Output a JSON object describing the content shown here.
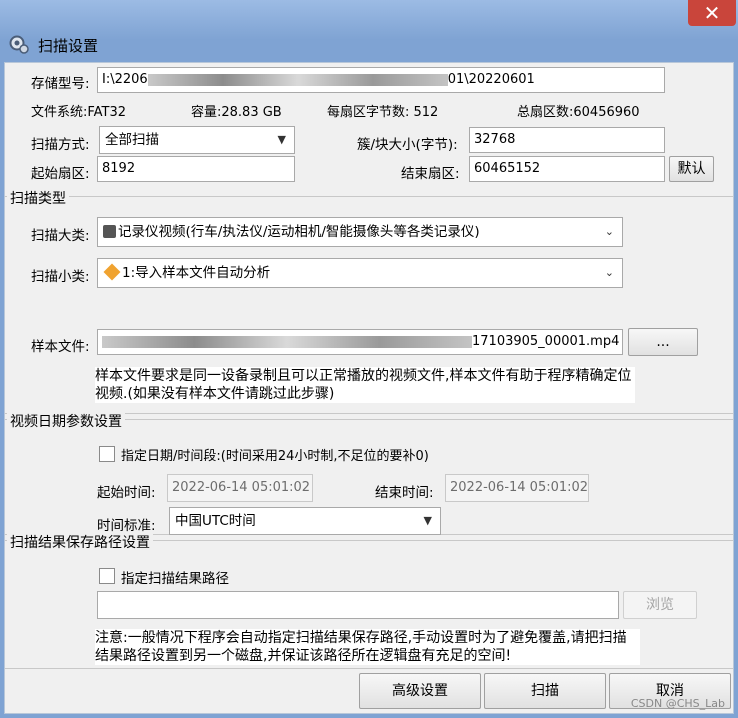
{
  "window": {
    "title": "扫描设置",
    "close_glyph": "✕",
    "icon": "gear-scan-icon"
  },
  "device": {
    "storage_label": "存储型号:",
    "storage_prefix": "I:\\2206",
    "storage_suffix": "01\\20220601",
    "fs_label": "文件系统:FAT32",
    "capacity_label": "容量:28.83 GB",
    "bytes_per_sector_label": "每扇区字节数: 512",
    "total_sectors_label": "总扇区数:60456960",
    "scan_mode_label": "扫描方式:",
    "scan_mode_value": "全部扫描",
    "cluster_label": "簇/块大小(字节):",
    "cluster_value": "32768",
    "start_sector_label": "起始扇区:",
    "start_sector_value": "8192",
    "end_sector_label": "结束扇区:",
    "end_sector_value": "60465152",
    "default_button": "默认"
  },
  "scan_type": {
    "group_title": "扫描类型",
    "major_label": "扫描大类:",
    "major_value": "记录仪视频(行车/执法仪/运动相机/智能摄像头等各类记录仪)",
    "minor_label": "扫描小类:",
    "minor_value": "1:导入样本文件自动分析",
    "sample_label": "样本文件:",
    "sample_suffix": "17103905_00001.mp4",
    "browse_dots": "...",
    "sample_note": "样本文件要求是同一设备录制且可以正常播放的视频文件,样本文件有助于程序精确定位视频.(如果没有样本文件请跳过此步骤)"
  },
  "date_params": {
    "group_title": "视频日期参数设置",
    "specify_label": "指定日期/时间段:(时间采用24小时制,不足位的要补0)",
    "start_label": "起始时间:",
    "start_value": "2022-06-14 05:01:02",
    "end_label": "结束时间:",
    "end_value": "2022-06-14 05:01:02",
    "tz_label": "时间标准:",
    "tz_value": "中国UTC时间"
  },
  "save_path": {
    "group_title": "扫描结果保存路径设置",
    "specify_label": "指定扫描结果路径",
    "path_value": "",
    "browse_button": "浏览",
    "note": "注意:一般情况下程序会自动指定扫描结果保存路径,手动设置时为了避免覆盖,请把扫描结果路径设置到另一个磁盘,并保证该路径所在逻辑盘有充足的空间!"
  },
  "footer": {
    "advanced_button": "高级设置",
    "scan_button": "扫描",
    "cancel_button": "取消",
    "watermark": "CSDN @CHS_Lab"
  }
}
